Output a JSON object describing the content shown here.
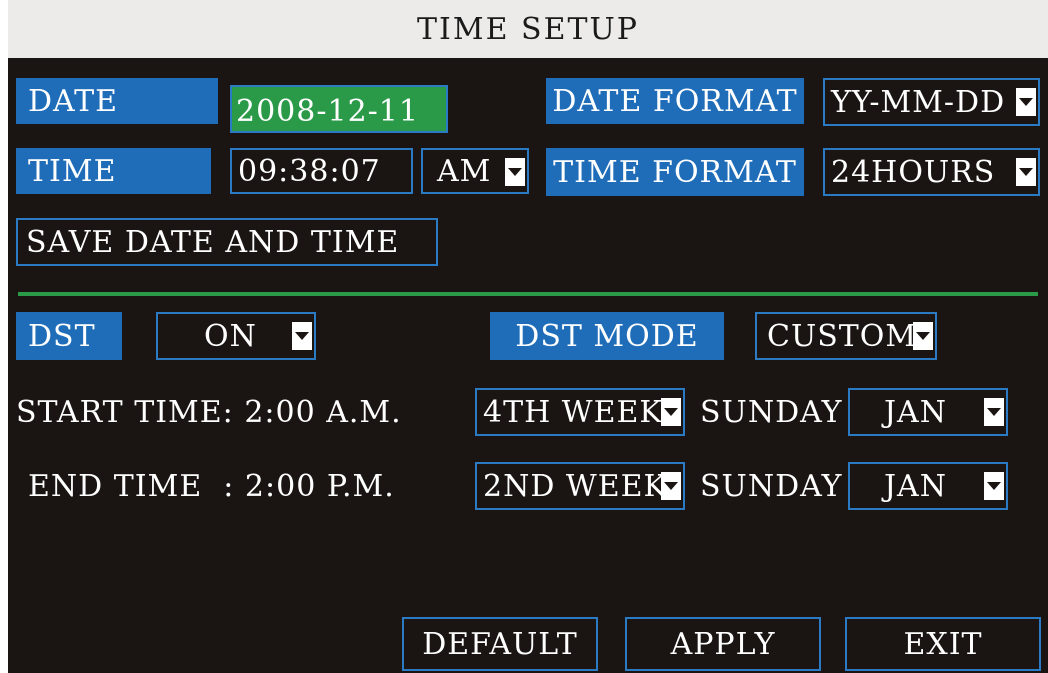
{
  "title": "TIME SETUP",
  "date": {
    "label": "DATE",
    "value": "2008-12-11"
  },
  "date_format": {
    "label": "DATE FORMAT",
    "value": "YY-MM-DD"
  },
  "time": {
    "label": "TIME",
    "value": "09:38:07",
    "ampm": "AM"
  },
  "time_format": {
    "label": "TIME FORMAT",
    "value": "24HOURS"
  },
  "save_button": "SAVE DATE AND TIME",
  "dst": {
    "label": "DST",
    "value": "ON"
  },
  "dst_mode": {
    "label": "DST MODE",
    "value": "CUSTOM"
  },
  "start": {
    "label": "START TIME: 2:00 A.M.",
    "week": "4TH WEEK",
    "day": "SUNDAY",
    "month": "JAN"
  },
  "end": {
    "label": "END TIME  : 2:00 P.M.",
    "week": "2ND WEEK",
    "day": "SUNDAY",
    "month": "JAN"
  },
  "buttons": {
    "default": "DEFAULT",
    "apply": "APPLY",
    "exit": "EXIT"
  },
  "colors": {
    "background": "#1a1412",
    "title_bar": "#ecebea",
    "label_blue": "#1f6db8",
    "border_blue": "#2b7ac4",
    "green": "#2a9a48"
  }
}
